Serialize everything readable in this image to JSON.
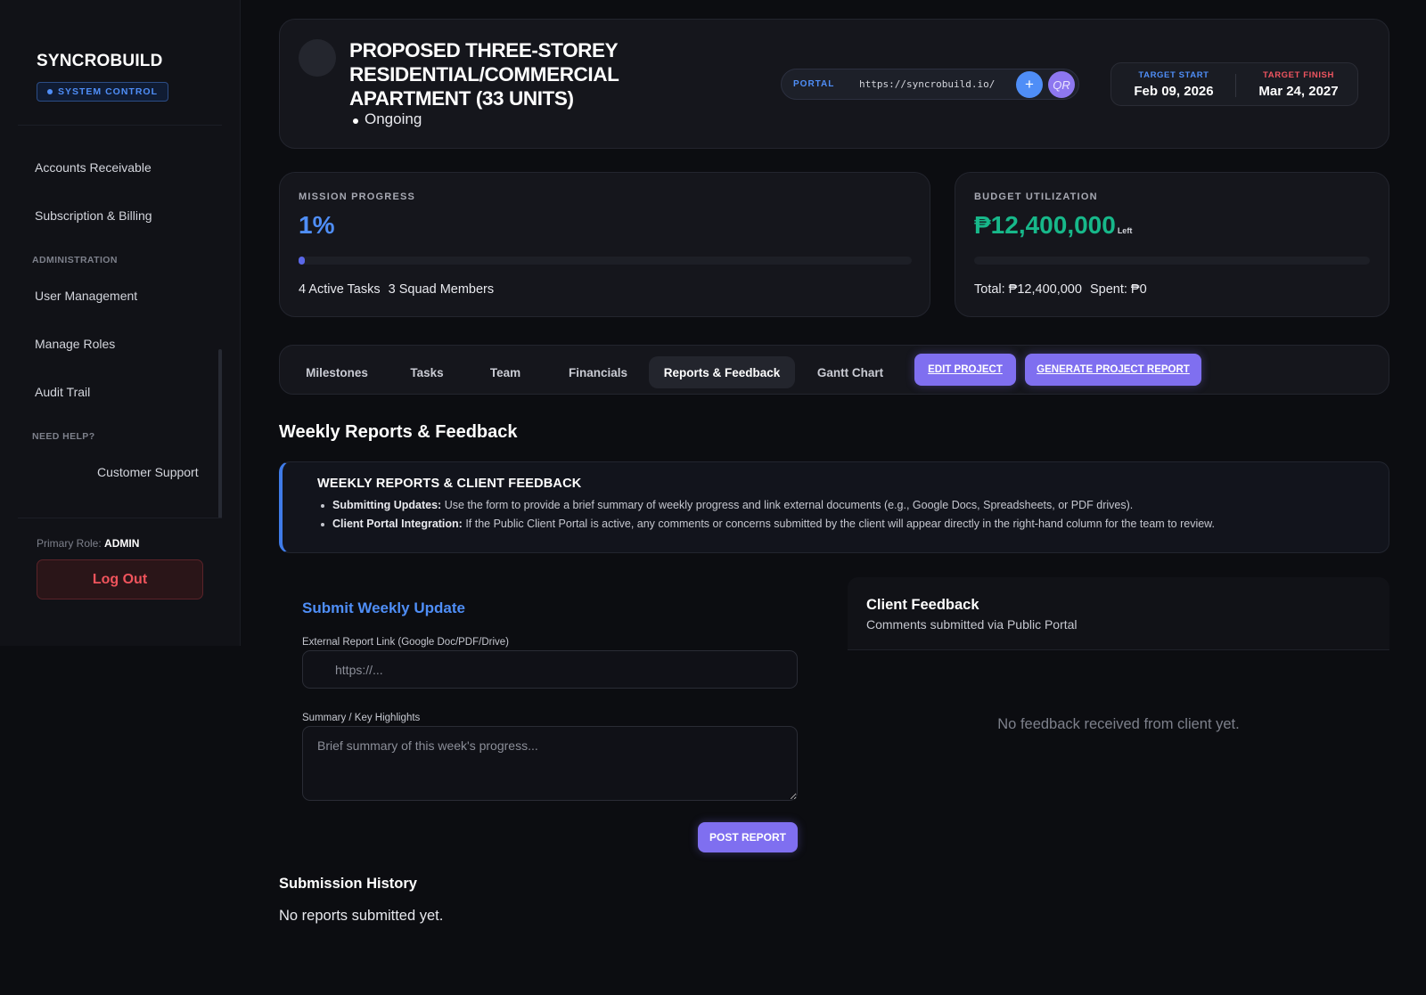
{
  "sidebar": {
    "brand": "SYNCROBUILD",
    "badge": "SYSTEM CONTROL",
    "items": [
      {
        "label": "Accounts Receivable"
      },
      {
        "label": "Subscription & Billing"
      },
      {
        "label": "User Management"
      },
      {
        "label": "Manage Roles"
      },
      {
        "label": "Audit Trail"
      },
      {
        "label": "Customer Support"
      }
    ],
    "sections": [
      "ADMINISTRATION",
      "NEED HELP?"
    ],
    "role_label": "Primary Role:",
    "role_value": "ADMIN",
    "logout_label": "Log Out"
  },
  "header": {
    "title": "PROPOSED THREE-STOREY RESIDENTIAL/COMMERCIAL APARTMENT (33 UNITS)",
    "status": "Ongoing",
    "portal_label": "PORTAL",
    "portal_url": "https://syncrobuild.io/",
    "portal_plus": "+",
    "portal_qr": "QR",
    "target_start_label": "TARGET START",
    "target_start": "Feb 09, 2026",
    "target_finish_label": "TARGET FINISH",
    "target_finish": "Mar 24, 2027"
  },
  "progress": {
    "label": "MISSION PROGRESS",
    "value": "1%",
    "fraction": 0.01,
    "active_tasks": "4 Active Tasks",
    "squad_members": "3 Squad Members"
  },
  "budget": {
    "label": "BUDGET UTILIZATION",
    "value": "₱12,400,000",
    "suffix": "Left",
    "fraction_spent": 0.0,
    "total": "Total: ₱12,400,000",
    "spent": "Spent: ₱0"
  },
  "tabs": [
    {
      "label": "Milestones"
    },
    {
      "label": "Tasks"
    },
    {
      "label": "Team"
    },
    {
      "label": "Financials"
    },
    {
      "label": "Reports & Feedback",
      "active": true
    },
    {
      "label": "Gantt Chart"
    }
  ],
  "actions": {
    "edit": "EDIT PROJECT",
    "generate": "GENERATE PROJECT REPORT"
  },
  "reports": {
    "section_title": "Weekly Reports & Feedback",
    "info_title": "WEEKLY REPORTS & CLIENT FEEDBACK",
    "info_items": [
      {
        "bold": "Submitting Updates:",
        "text": " Use the form to provide a brief summary of weekly progress and link external documents (e.g., Google Docs, Spreadsheets, or PDF drives)."
      },
      {
        "bold": "Client Portal Integration:",
        "text": " If the Public Client Portal is active, any comments or concerns submitted by the client will appear directly in the right-hand column for the team to review."
      }
    ],
    "form_title": "Submit Weekly Update",
    "link_label": "External Report Link (Google Doc/PDF/Drive)",
    "link_placeholder": "https://...",
    "summary_label": "Summary / Key Highlights",
    "summary_placeholder": "Brief summary of this week's progress...",
    "post_label": "POST REPORT",
    "history_title": "Submission History",
    "history_empty": "No reports submitted yet."
  },
  "feedback": {
    "title": "Client Feedback",
    "subtitle": "Comments submitted via Public Portal",
    "empty": "No feedback received from client yet."
  },
  "colors": {
    "accent_blue": "#4f8ef7",
    "accent_purple": "#7f6ff0",
    "budget_green": "#17b88a",
    "danger_red": "#f0545c"
  }
}
